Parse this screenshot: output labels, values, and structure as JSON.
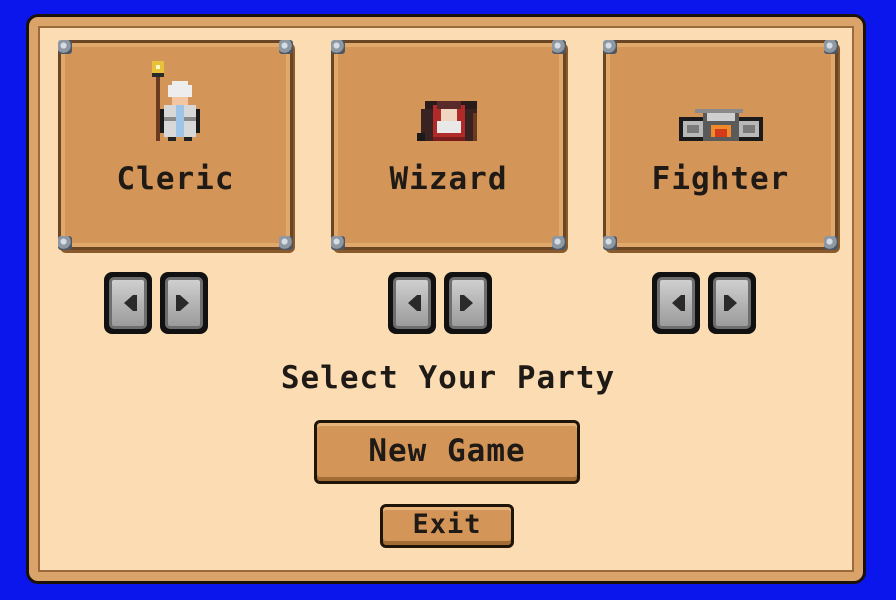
{
  "screen": "party-select",
  "characters": [
    {
      "label": "Cleric",
      "sprite": "cleric-sprite-icon"
    },
    {
      "label": "Wizard",
      "sprite": "wizard-sprite-icon"
    },
    {
      "label": "Fighter",
      "sprite": "fighter-sprite-icon"
    }
  ],
  "prompt": "Select Your Party",
  "buttons": {
    "new_game": "New Game",
    "exit": "Exit"
  },
  "colors": {
    "background": "#0b16ec",
    "panel": "#fbdcb3",
    "card": "#d49658",
    "text": "#1f1a15"
  }
}
